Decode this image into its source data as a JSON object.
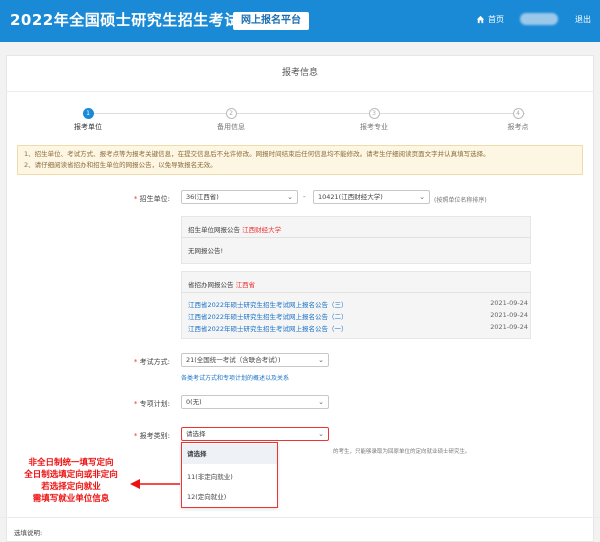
{
  "header": {
    "title": "2022年全国硕士研究生招生考试",
    "badge": "网上报名平台",
    "home": "首页",
    "logout": "退出"
  },
  "card": {
    "title": "报考信息"
  },
  "steps": [
    {
      "num": "1",
      "label": "报考单位"
    },
    {
      "num": "2",
      "label": "备用信息"
    },
    {
      "num": "3",
      "label": "报考专业"
    },
    {
      "num": "4",
      "label": "报考点"
    }
  ],
  "notice": {
    "line1": "1、招生单位、考试方式、报考点等为报考关键信息，在提交信息后不允许修改。网报时间结束后任何信息均不能修改。请考生仔细阅读页面文字并认真填写选择。",
    "line2": "2、请仔细阅读省招办和招生单位的网报公告，以免导致报名无效。"
  },
  "form": {
    "unit_label": "招生单位:",
    "province_value": "36(江西省)",
    "dash": "-",
    "school_value": "10421(江西财经大学)",
    "search_hint": "(按照单位名称排序)",
    "exam_label": "考试方式:",
    "exam_value": "21(全国统一考试（含联合考试）)",
    "exam_link": "各类考试方式和专项计划的概述以及关系",
    "plan_label": "专项计划:",
    "plan_value": "0(无)",
    "type_label": "报考类别:",
    "type_value": "请选择",
    "type_hint": "的考生，只能够录取为回原单位的定向就业硕士研究生。",
    "footer_label": "选填说明:"
  },
  "school_notice": {
    "title": "招生单位网报公告",
    "school": "江西财经大学",
    "body": "无网报公告!"
  },
  "province_notice": {
    "title": "省招办网报公告",
    "province": "江西省",
    "items": [
      {
        "text": "江西省2022年硕士研究生招生考试网上报名公告（三）",
        "date": "2021-09-24"
      },
      {
        "text": "江西省2022年硕士研究生招生考试网上报名公告（二）",
        "date": "2021-09-24"
      },
      {
        "text": "江西省2022年硕士研究生招生考试网上报名公告（一）",
        "date": "2021-09-24"
      }
    ]
  },
  "dropdown_options": [
    "请选择",
    "11(非定向就业)",
    "12(定向就业)"
  ],
  "annotation": {
    "lines": [
      "非全日制统一填写定向",
      "全日制选填定向或非定向",
      "若选择定向就业",
      "需填写就业单位信息"
    ]
  },
  "colors": {
    "header_bg": "#1a8ad6",
    "annotation": "#e11111",
    "link": "#1a73c8"
  }
}
